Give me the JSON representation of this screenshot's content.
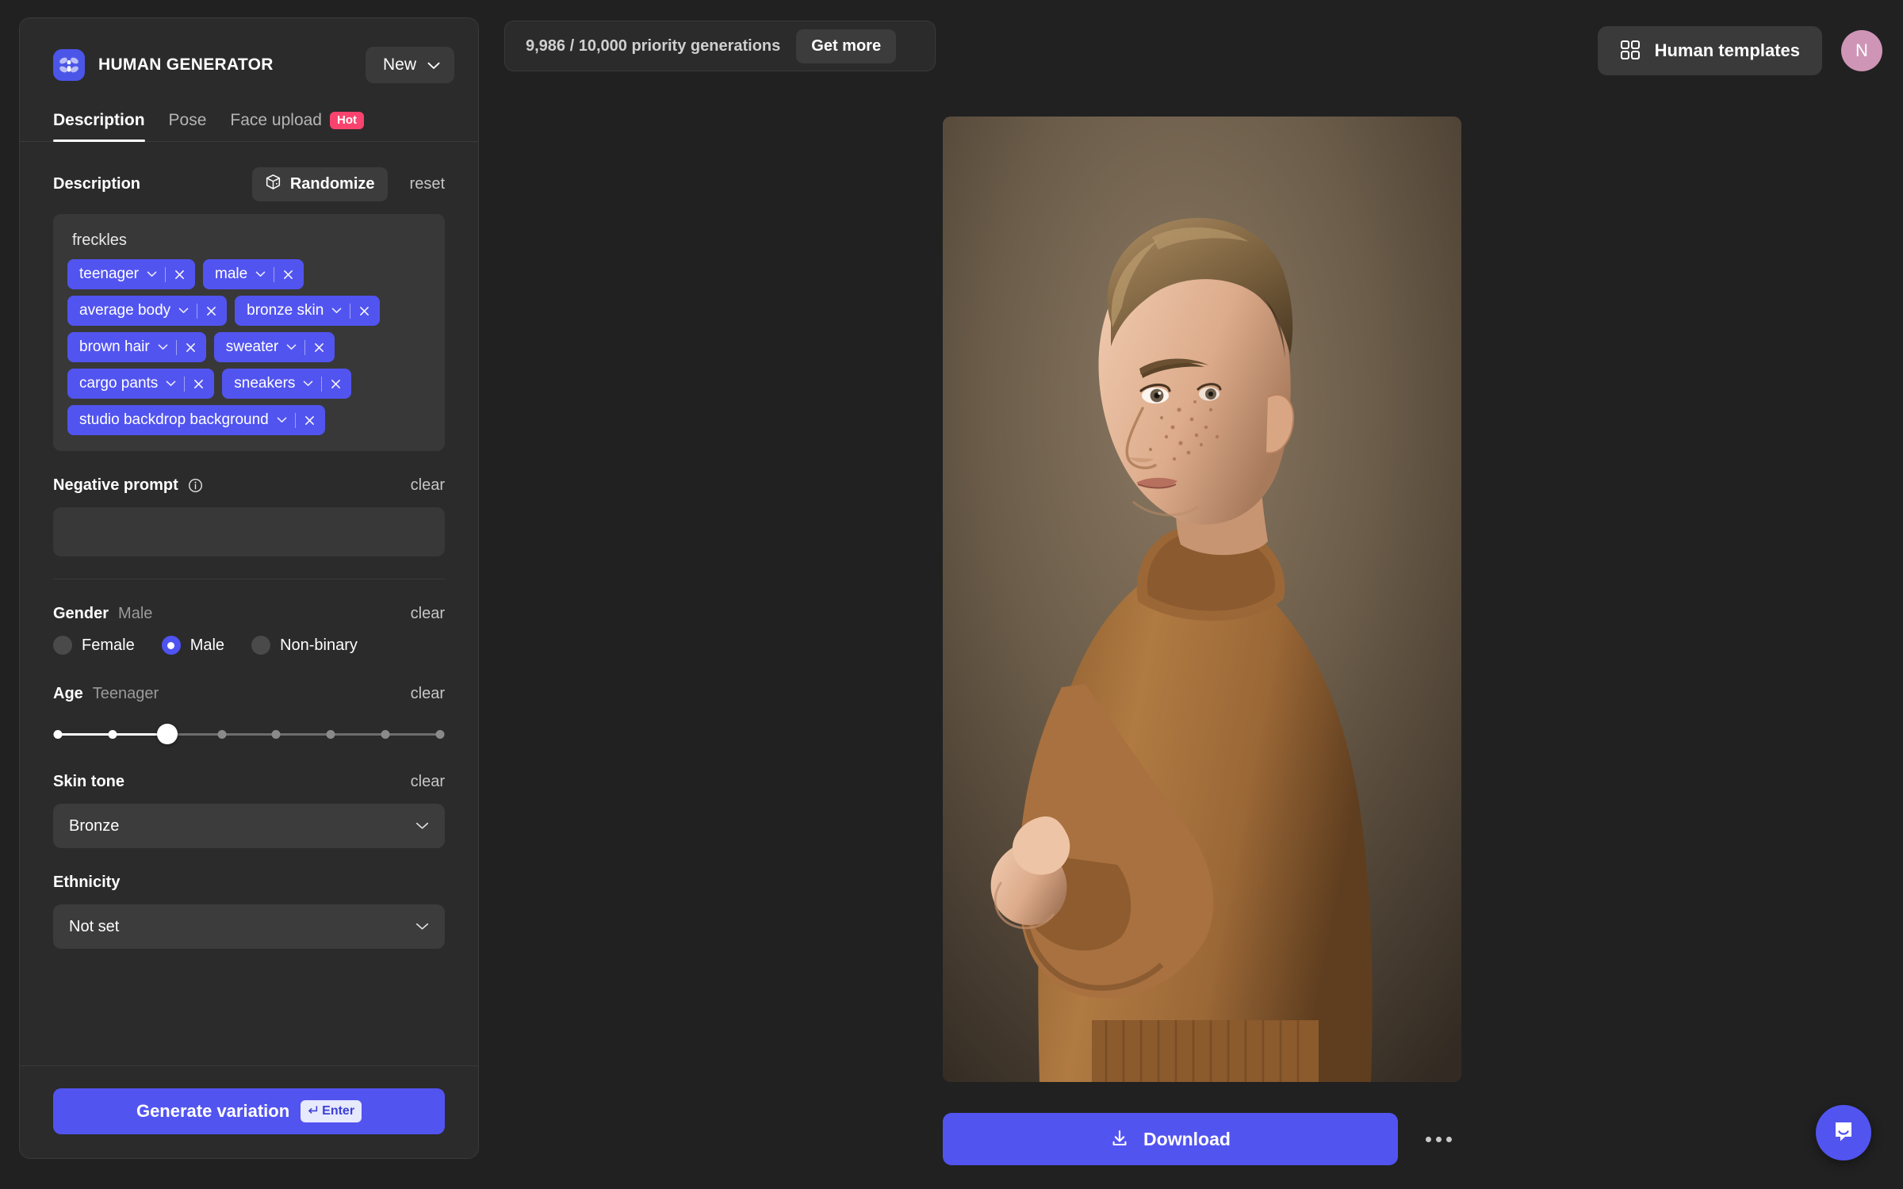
{
  "brand": {
    "name": "HUMAN GENERATOR",
    "logo_icon": "flower-logo-icon",
    "new_button": "New"
  },
  "tabs": [
    {
      "label": "Description",
      "active": true,
      "badge": null
    },
    {
      "label": "Pose",
      "active": false,
      "badge": null
    },
    {
      "label": "Face upload",
      "active": false,
      "badge": "Hot"
    }
  ],
  "description": {
    "title": "Description",
    "randomize_label": "Randomize",
    "randomize_icon": "dice-icon",
    "reset_label": "reset",
    "prompt_lead": "freckles",
    "chips": [
      {
        "label": "teenager"
      },
      {
        "label": "male"
      },
      {
        "label": "average body"
      },
      {
        "label": "bronze skin"
      },
      {
        "label": "brown hair"
      },
      {
        "label": "sweater"
      },
      {
        "label": "cargo pants"
      },
      {
        "label": "sneakers"
      },
      {
        "label": "studio backdrop background"
      }
    ]
  },
  "negative_prompt": {
    "title": "Negative prompt",
    "info_icon": "info-icon",
    "clear_label": "clear",
    "value": "",
    "placeholder": ""
  },
  "gender": {
    "title": "Gender",
    "value": "Male",
    "clear_label": "clear",
    "options": [
      {
        "label": "Female",
        "selected": false
      },
      {
        "label": "Male",
        "selected": true
      },
      {
        "label": "Non-binary",
        "selected": false
      }
    ]
  },
  "age": {
    "title": "Age",
    "value": "Teenager",
    "clear_label": "clear",
    "steps": 8,
    "current_index": 2
  },
  "skin_tone": {
    "title": "Skin tone",
    "clear_label": "clear",
    "value": "Bronze"
  },
  "ethnicity": {
    "title": "Ethnicity",
    "value": "Not set"
  },
  "generate": {
    "label": "Generate variation",
    "shortcut": "Enter",
    "shortcut_icon": "enter-arrow-icon"
  },
  "topbar": {
    "credits": "9,986 / 10,000 priority generations",
    "get_more_label": "Get more",
    "templates_label": "Human templates",
    "templates_icon": "grid-icon",
    "avatar_initial": "N"
  },
  "canvas": {
    "image_alt": "generated teenage male portrait in brown sweater on studio backdrop",
    "download_label": "Download",
    "download_icon": "download-icon",
    "more_icon": "ellipsis-icon"
  },
  "support": {
    "icon": "chat-bubble-icon"
  },
  "colors": {
    "accent": "#5254f0",
    "panel_bg": "#2b2b2b",
    "page_bg": "#212121",
    "chip_bg": "#5254f0",
    "hot_badge": "#f8436e",
    "avatar_bg": "#cf95b6"
  }
}
